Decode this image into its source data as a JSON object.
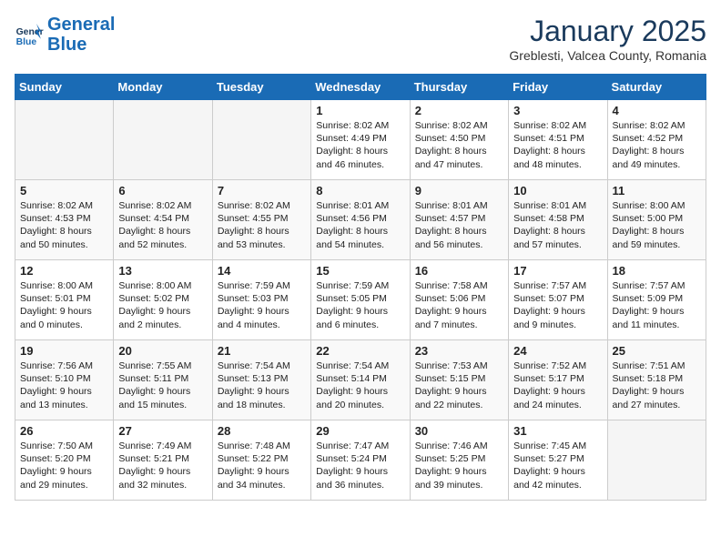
{
  "header": {
    "logo_line1": "General",
    "logo_line2": "Blue",
    "month_title": "January 2025",
    "location": "Greblesti, Valcea County, Romania"
  },
  "weekdays": [
    "Sunday",
    "Monday",
    "Tuesday",
    "Wednesday",
    "Thursday",
    "Friday",
    "Saturday"
  ],
  "weeks": [
    [
      {
        "day": "",
        "empty": true
      },
      {
        "day": "",
        "empty": true
      },
      {
        "day": "",
        "empty": true
      },
      {
        "day": "1",
        "lines": [
          "Sunrise: 8:02 AM",
          "Sunset: 4:49 PM",
          "Daylight: 8 hours",
          "and 46 minutes."
        ]
      },
      {
        "day": "2",
        "lines": [
          "Sunrise: 8:02 AM",
          "Sunset: 4:50 PM",
          "Daylight: 8 hours",
          "and 47 minutes."
        ]
      },
      {
        "day": "3",
        "lines": [
          "Sunrise: 8:02 AM",
          "Sunset: 4:51 PM",
          "Daylight: 8 hours",
          "and 48 minutes."
        ]
      },
      {
        "day": "4",
        "lines": [
          "Sunrise: 8:02 AM",
          "Sunset: 4:52 PM",
          "Daylight: 8 hours",
          "and 49 minutes."
        ]
      }
    ],
    [
      {
        "day": "5",
        "lines": [
          "Sunrise: 8:02 AM",
          "Sunset: 4:53 PM",
          "Daylight: 8 hours",
          "and 50 minutes."
        ]
      },
      {
        "day": "6",
        "lines": [
          "Sunrise: 8:02 AM",
          "Sunset: 4:54 PM",
          "Daylight: 8 hours",
          "and 52 minutes."
        ]
      },
      {
        "day": "7",
        "lines": [
          "Sunrise: 8:02 AM",
          "Sunset: 4:55 PM",
          "Daylight: 8 hours",
          "and 53 minutes."
        ]
      },
      {
        "day": "8",
        "lines": [
          "Sunrise: 8:01 AM",
          "Sunset: 4:56 PM",
          "Daylight: 8 hours",
          "and 54 minutes."
        ]
      },
      {
        "day": "9",
        "lines": [
          "Sunrise: 8:01 AM",
          "Sunset: 4:57 PM",
          "Daylight: 8 hours",
          "and 56 minutes."
        ]
      },
      {
        "day": "10",
        "lines": [
          "Sunrise: 8:01 AM",
          "Sunset: 4:58 PM",
          "Daylight: 8 hours",
          "and 57 minutes."
        ]
      },
      {
        "day": "11",
        "lines": [
          "Sunrise: 8:00 AM",
          "Sunset: 5:00 PM",
          "Daylight: 8 hours",
          "and 59 minutes."
        ]
      }
    ],
    [
      {
        "day": "12",
        "lines": [
          "Sunrise: 8:00 AM",
          "Sunset: 5:01 PM",
          "Daylight: 9 hours",
          "and 0 minutes."
        ]
      },
      {
        "day": "13",
        "lines": [
          "Sunrise: 8:00 AM",
          "Sunset: 5:02 PM",
          "Daylight: 9 hours",
          "and 2 minutes."
        ]
      },
      {
        "day": "14",
        "lines": [
          "Sunrise: 7:59 AM",
          "Sunset: 5:03 PM",
          "Daylight: 9 hours",
          "and 4 minutes."
        ]
      },
      {
        "day": "15",
        "lines": [
          "Sunrise: 7:59 AM",
          "Sunset: 5:05 PM",
          "Daylight: 9 hours",
          "and 6 minutes."
        ]
      },
      {
        "day": "16",
        "lines": [
          "Sunrise: 7:58 AM",
          "Sunset: 5:06 PM",
          "Daylight: 9 hours",
          "and 7 minutes."
        ]
      },
      {
        "day": "17",
        "lines": [
          "Sunrise: 7:57 AM",
          "Sunset: 5:07 PM",
          "Daylight: 9 hours",
          "and 9 minutes."
        ]
      },
      {
        "day": "18",
        "lines": [
          "Sunrise: 7:57 AM",
          "Sunset: 5:09 PM",
          "Daylight: 9 hours",
          "and 11 minutes."
        ]
      }
    ],
    [
      {
        "day": "19",
        "lines": [
          "Sunrise: 7:56 AM",
          "Sunset: 5:10 PM",
          "Daylight: 9 hours",
          "and 13 minutes."
        ]
      },
      {
        "day": "20",
        "lines": [
          "Sunrise: 7:55 AM",
          "Sunset: 5:11 PM",
          "Daylight: 9 hours",
          "and 15 minutes."
        ]
      },
      {
        "day": "21",
        "lines": [
          "Sunrise: 7:54 AM",
          "Sunset: 5:13 PM",
          "Daylight: 9 hours",
          "and 18 minutes."
        ]
      },
      {
        "day": "22",
        "lines": [
          "Sunrise: 7:54 AM",
          "Sunset: 5:14 PM",
          "Daylight: 9 hours",
          "and 20 minutes."
        ]
      },
      {
        "day": "23",
        "lines": [
          "Sunrise: 7:53 AM",
          "Sunset: 5:15 PM",
          "Daylight: 9 hours",
          "and 22 minutes."
        ]
      },
      {
        "day": "24",
        "lines": [
          "Sunrise: 7:52 AM",
          "Sunset: 5:17 PM",
          "Daylight: 9 hours",
          "and 24 minutes."
        ]
      },
      {
        "day": "25",
        "lines": [
          "Sunrise: 7:51 AM",
          "Sunset: 5:18 PM",
          "Daylight: 9 hours",
          "and 27 minutes."
        ]
      }
    ],
    [
      {
        "day": "26",
        "lines": [
          "Sunrise: 7:50 AM",
          "Sunset: 5:20 PM",
          "Daylight: 9 hours",
          "and 29 minutes."
        ]
      },
      {
        "day": "27",
        "lines": [
          "Sunrise: 7:49 AM",
          "Sunset: 5:21 PM",
          "Daylight: 9 hours",
          "and 32 minutes."
        ]
      },
      {
        "day": "28",
        "lines": [
          "Sunrise: 7:48 AM",
          "Sunset: 5:22 PM",
          "Daylight: 9 hours",
          "and 34 minutes."
        ]
      },
      {
        "day": "29",
        "lines": [
          "Sunrise: 7:47 AM",
          "Sunset: 5:24 PM",
          "Daylight: 9 hours",
          "and 36 minutes."
        ]
      },
      {
        "day": "30",
        "lines": [
          "Sunrise: 7:46 AM",
          "Sunset: 5:25 PM",
          "Daylight: 9 hours",
          "and 39 minutes."
        ]
      },
      {
        "day": "31",
        "lines": [
          "Sunrise: 7:45 AM",
          "Sunset: 5:27 PM",
          "Daylight: 9 hours",
          "and 42 minutes."
        ]
      },
      {
        "day": "",
        "empty": true
      }
    ]
  ]
}
